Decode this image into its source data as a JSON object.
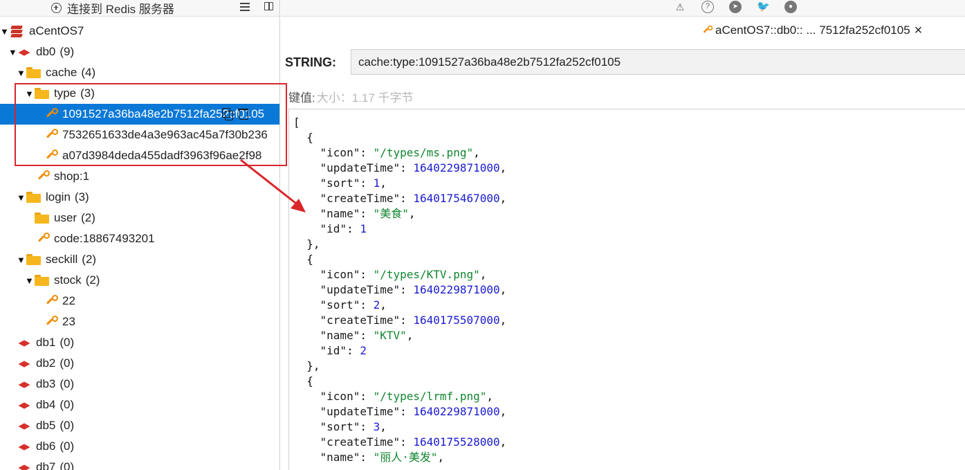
{
  "toolbar": {
    "connect_label": "连接到 Redis 服务器",
    "list_icon": "list-icon",
    "panel_icon": "panel-toggle-icon"
  },
  "top_icons": [
    "warning-icon",
    "help-icon",
    "telegram-icon",
    "twitter-icon",
    "github-icon"
  ],
  "tree": {
    "server": "aCentOS7",
    "db0": {
      "label": "db0",
      "count": "(9)"
    },
    "folders": {
      "cache": {
        "label": "cache",
        "count": "(4)"
      },
      "type": {
        "label": "type",
        "count": "(3)"
      },
      "login": {
        "label": "login",
        "count": "(3)"
      },
      "user": {
        "label": "user",
        "count": "(2)"
      },
      "seckill": {
        "label": "seckill",
        "count": "(2)"
      },
      "stock": {
        "label": "stock",
        "count": "(2)"
      }
    },
    "keys": {
      "type_key_1": "1091527a36ba48e2b7512fa252cf0105",
      "type_key_2": "7532651633de4a3e963ac45a7f30b236",
      "type_key_3": "a07d3984deda455dadf3963f96ae2f98",
      "shop": "shop:1",
      "code": "code:18867493201",
      "stock_22": "22",
      "stock_23": "23"
    },
    "dbs": [
      {
        "label": "db1",
        "count": "(0)"
      },
      {
        "label": "db2",
        "count": "(0)"
      },
      {
        "label": "db3",
        "count": "(0)"
      },
      {
        "label": "db4",
        "count": "(0)"
      },
      {
        "label": "db5",
        "count": "(0)"
      },
      {
        "label": "db6",
        "count": "(0)"
      },
      {
        "label": "db7",
        "count": "(0)"
      }
    ]
  },
  "tab": {
    "title": "aCentOS7::db0:: ... 7512fa252cf0105",
    "close": "×"
  },
  "detail": {
    "type_label": "STRING:",
    "key_name": "cache:type:1091527a36ba48e2b7512fa252cf0105",
    "value_label": "键值:",
    "size_text": "大小：1.17 千字节"
  },
  "json_value": [
    {
      "icon": "/types/ms.png",
      "updateTime": "1640229871000",
      "sort": "1",
      "createTime": "1640175467000",
      "name": "美食",
      "id": "1"
    },
    {
      "icon": "/types/KTV.png",
      "updateTime": "1640229871000",
      "sort": "2",
      "createTime": "1640175507000",
      "name": "KTV",
      "id": "2"
    },
    {
      "icon": "/types/lrmf.png",
      "updateTime": "1640229871000",
      "sort": "3",
      "createTime": "1640175528000",
      "name": "丽人·美发"
    }
  ],
  "colors": {
    "selection": "#0a78d7",
    "highlight_box": "#d9262b",
    "key_icon": "#f08c00",
    "folder": "#f6b71e",
    "db_icon": "#d9302b",
    "json_string": "#11862f",
    "json_number": "#1a1ad0"
  }
}
